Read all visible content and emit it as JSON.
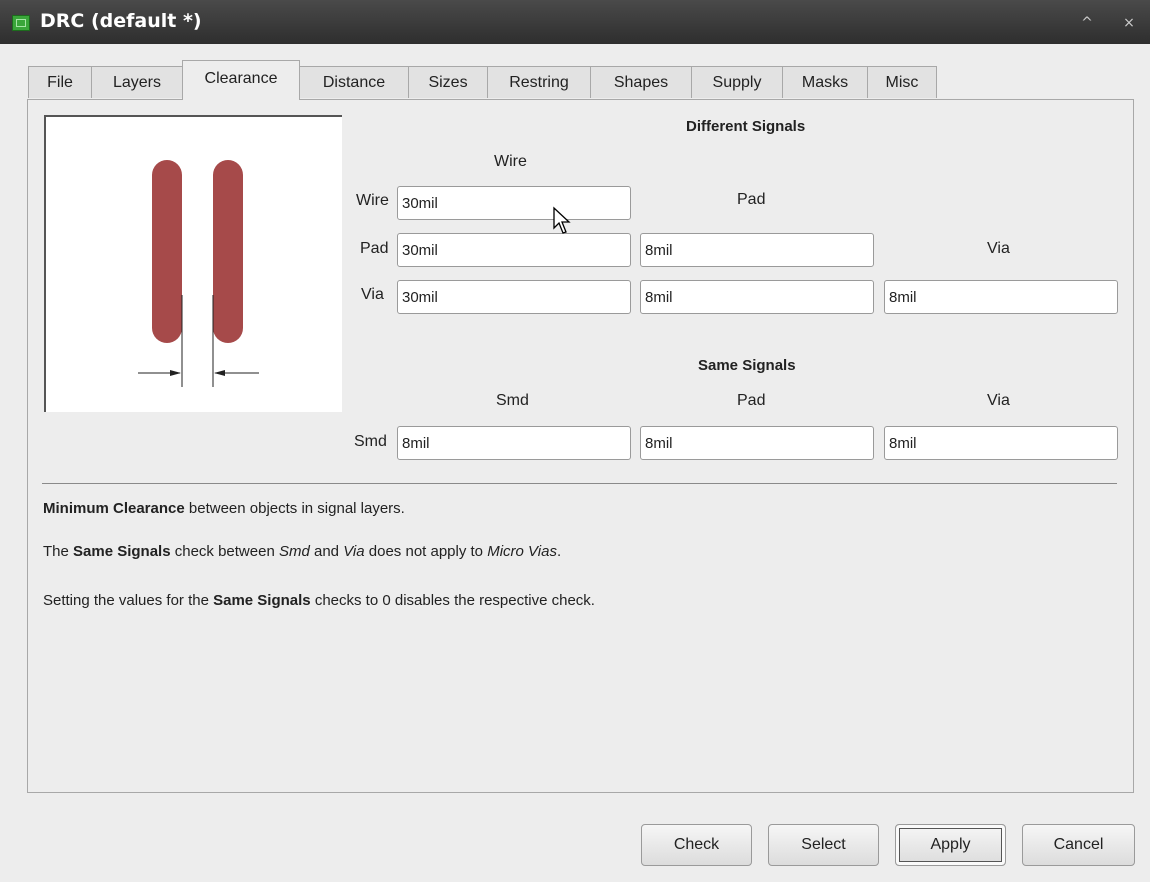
{
  "window": {
    "title": "DRC (default *)"
  },
  "tabs": [
    {
      "label": "File",
      "active": false
    },
    {
      "label": "Layers",
      "active": false
    },
    {
      "label": "Clearance",
      "active": true
    },
    {
      "label": "Distance",
      "active": false
    },
    {
      "label": "Sizes",
      "active": false
    },
    {
      "label": "Restring",
      "active": false
    },
    {
      "label": "Shapes",
      "active": false
    },
    {
      "label": "Supply",
      "active": false
    },
    {
      "label": "Masks",
      "active": false
    },
    {
      "label": "Misc",
      "active": false
    }
  ],
  "different_signals": {
    "heading": "Different Signals",
    "col_wire": "Wire",
    "col_pad": "Pad",
    "col_via": "Via",
    "row_wire": "Wire",
    "row_pad": "Pad",
    "row_via": "Via",
    "wire_wire": "30mil",
    "pad_wire": "30mil",
    "pad_pad": "8mil",
    "via_wire": "30mil",
    "via_pad": "8mil",
    "via_via": "8mil"
  },
  "same_signals": {
    "heading": "Same Signals",
    "col_smd": "Smd",
    "col_pad": "Pad",
    "col_via": "Via",
    "row_smd": "Smd",
    "smd_smd": "8mil",
    "smd_pad": "8mil",
    "smd_via": "8mil"
  },
  "notes": {
    "line1_bold": "Minimum Clearance",
    "line1_rest": " between objects in signal layers.",
    "line2_a": "The ",
    "line2_bold": "Same Signals",
    "line2_b": " check between ",
    "line2_it1": "Smd",
    "line2_c": " and ",
    "line2_it2": "Via",
    "line2_d": " does not apply to ",
    "line2_it3": "Micro Vias",
    "line2_e": ".",
    "line3_a": "Setting the values for the ",
    "line3_bold": "Same Signals",
    "line3_b": " checks to 0 disables the respective check."
  },
  "buttons": {
    "check": "Check",
    "select": "Select",
    "apply": "Apply",
    "cancel": "Cancel"
  },
  "colors": {
    "trace": "#a64a4a",
    "titlebar": "#3a3a3a"
  }
}
